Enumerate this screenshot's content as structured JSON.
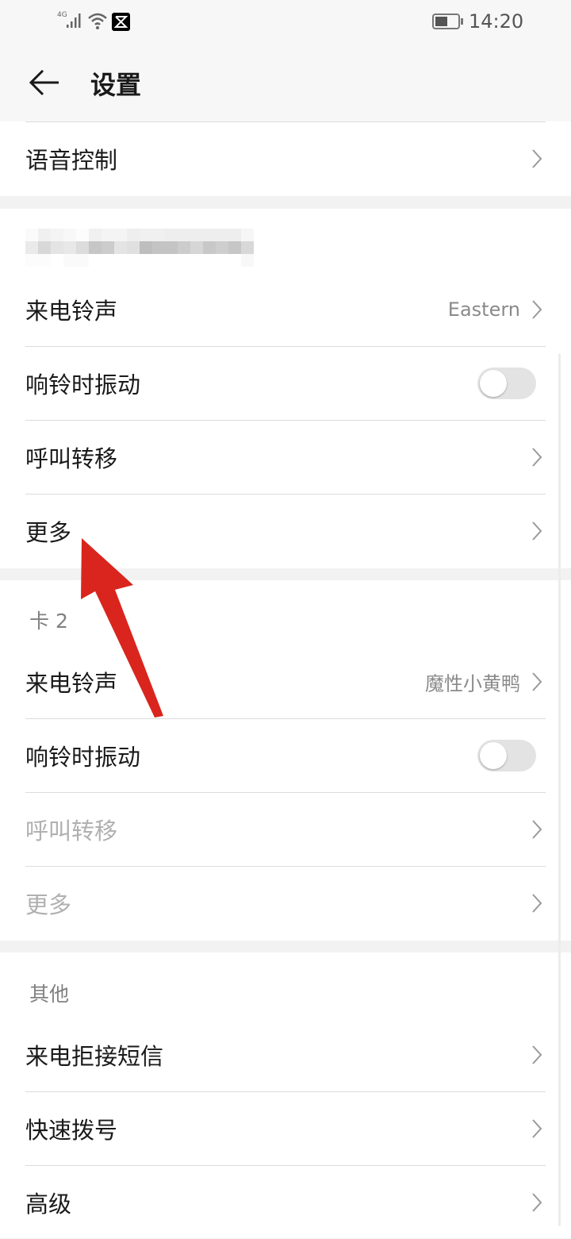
{
  "status_bar": {
    "network": "4G",
    "time": "14:20",
    "icons": [
      "signal-icon",
      "wifi-icon",
      "capcut-app-icon",
      "battery-icon"
    ]
  },
  "header": {
    "title": "设置",
    "back_icon": "arrow-left-icon"
  },
  "top_item": {
    "label": "语音控制"
  },
  "card1": {
    "items": [
      {
        "label": "来电铃声",
        "value": "Eastern"
      },
      {
        "label": "响铃时振动",
        "toggle": false
      },
      {
        "label": "呼叫转移"
      },
      {
        "label": "更多"
      }
    ]
  },
  "card2": {
    "title": "卡 2",
    "items": [
      {
        "label": "来电铃声",
        "value": "魔性小黄鸭"
      },
      {
        "label": "响铃时振动",
        "toggle": false
      },
      {
        "label": "呼叫转移",
        "disabled": true
      },
      {
        "label": "更多",
        "disabled": true
      }
    ]
  },
  "other": {
    "title": "其他",
    "items": [
      {
        "label": "来电拒接短信"
      },
      {
        "label": "快速拨号"
      },
      {
        "label": "高级"
      }
    ]
  },
  "annotation": {
    "color": "#d9251d",
    "points_to": "更多"
  }
}
